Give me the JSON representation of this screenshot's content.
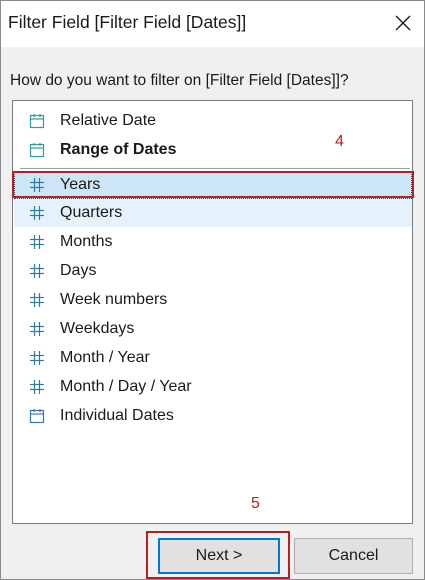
{
  "dialog": {
    "title": "Filter Field [Filter Field [Dates]]",
    "question": "How do you want to filter on [Filter Field [Dates]]?"
  },
  "list": {
    "top_items": [
      {
        "label": "Relative Date",
        "icon": "calendar-icon",
        "bold": false
      },
      {
        "label": "Range of Dates",
        "icon": "calendar-icon",
        "bold": true
      }
    ],
    "items": [
      {
        "label": "Years",
        "icon": "hash-icon",
        "state": "selected"
      },
      {
        "label": "Quarters",
        "icon": "hash-icon",
        "state": "hover"
      },
      {
        "label": "Months",
        "icon": "hash-icon",
        "state": ""
      },
      {
        "label": "Days",
        "icon": "hash-icon",
        "state": ""
      },
      {
        "label": "Week numbers",
        "icon": "hash-icon",
        "state": ""
      },
      {
        "label": "Weekdays",
        "icon": "hash-icon",
        "state": ""
      },
      {
        "label": "Month / Year",
        "icon": "hash-icon",
        "state": ""
      },
      {
        "label": "Month / Day / Year",
        "icon": "hash-icon",
        "state": ""
      },
      {
        "label": "Individual Dates",
        "icon": "calendar-icon",
        "state": ""
      }
    ]
  },
  "annotations": {
    "step_4": "4",
    "step_5": "5",
    "color": "#b22222"
  },
  "buttons": {
    "next": "Next >",
    "cancel": "Cancel"
  },
  "colors": {
    "calendar_icon_top": "#2e9c9c",
    "calendar_icon_bottom": "#3a78b5",
    "hash_icon": "#2e7d9c",
    "selection": "#cde6f7",
    "hover": "#e5f1fb",
    "default_button_border": "#0078d7"
  }
}
